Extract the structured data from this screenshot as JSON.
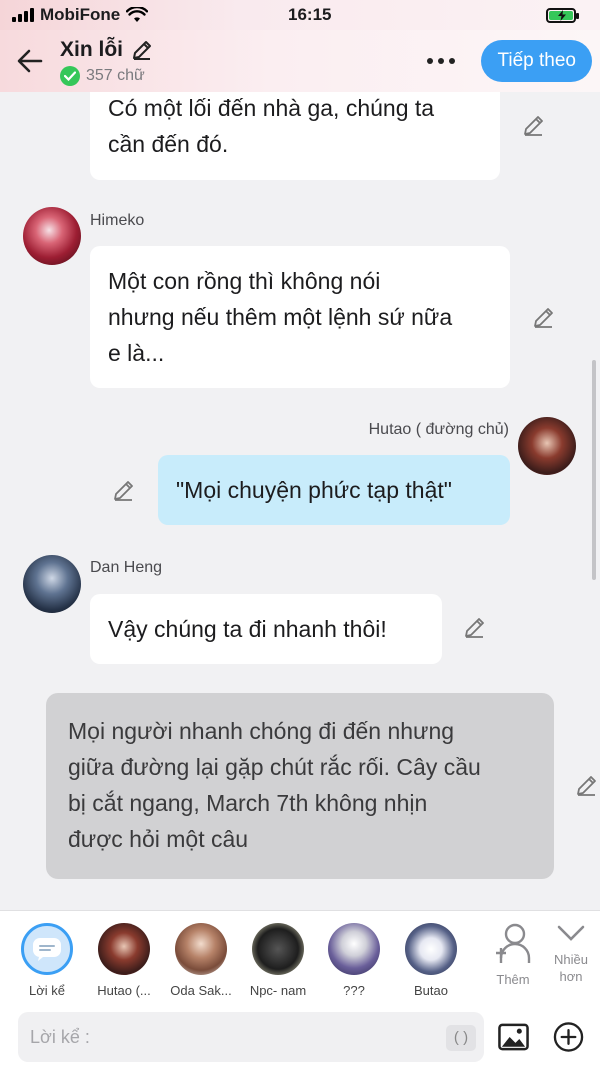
{
  "status": {
    "carrier": "MobiFone",
    "time": "16:15"
  },
  "header": {
    "title": "Xin lỗi",
    "word_count": "357 chữ",
    "next_label": "Tiếp theo"
  },
  "messages": [
    {
      "text_lines": [
        "Có một lối đến nhà ga, chúng ta",
        "cần đến đó."
      ]
    },
    {
      "speaker": "Himeko",
      "text_lines": [
        "Một con rồng thì không nói",
        "nhưng nếu thêm một lệnh sứ nữa",
        "e là..."
      ]
    },
    {
      "speaker": "Hutao ( đường chủ)",
      "text_lines": [
        "\"Mọi chuyện phức tạp thật\""
      ]
    },
    {
      "speaker": "Dan Heng",
      "text_lines": [
        "Vậy chúng ta đi nhanh thôi!"
      ]
    },
    {
      "text_lines": [
        "Mọi người nhanh chóng đi đến nhưng",
        "giữa đường lại gặp chút rắc rối. Cây cầu",
        "bị cắt ngang, March 7th không nhịn",
        "được hỏi một câu"
      ]
    }
  ],
  "characters": [
    {
      "label": "Lời kể"
    },
    {
      "label": "Hutao (..."
    },
    {
      "label": "Oda Sak..."
    },
    {
      "label": "Npc- nam"
    },
    {
      "label": "???"
    },
    {
      "label": "Butao"
    }
  ],
  "actions": {
    "add_label": "Thêm",
    "more_label_1": "Nhiều",
    "more_label_2": "hơn"
  },
  "input": {
    "placeholder": "Lời kể :",
    "paren": "( )"
  },
  "colors": {
    "accent": "#3b9ff4",
    "user_bubble": "#c8ecfb",
    "narration_bubble": "#d1d1d3",
    "verified": "#35c759"
  }
}
